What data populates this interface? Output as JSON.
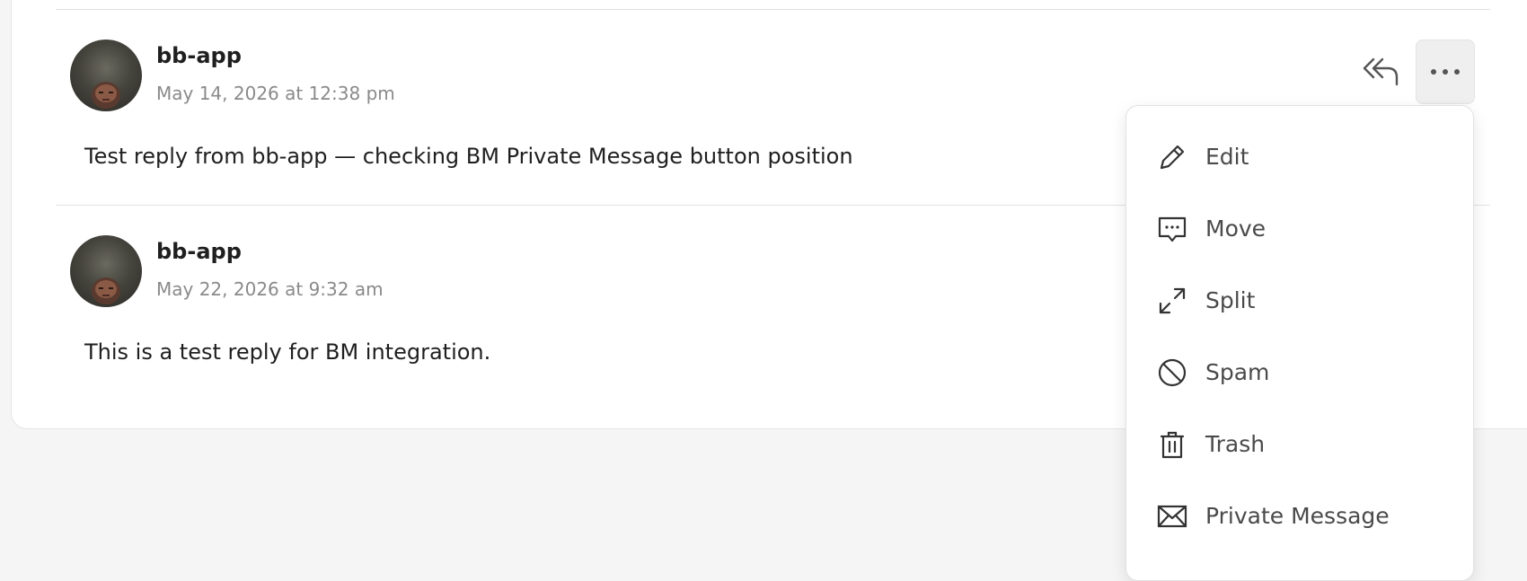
{
  "replies": [
    {
      "author": "bb-app",
      "date": "May 14, 2026 at 12:38 pm",
      "text": "Test reply from bb-app — checking BM Private Message button position"
    },
    {
      "author": "bb-app",
      "date": "May 22, 2026 at 9:32 am",
      "text": "This is a test reply for BM integration."
    }
  ],
  "actions": {
    "reply_icon": "reply-all-icon",
    "more_icon": "ellipsis-icon"
  },
  "menu": {
    "items": [
      {
        "label": "Edit",
        "icon": "pencil-icon"
      },
      {
        "label": "Move",
        "icon": "message-dots-icon"
      },
      {
        "label": "Split",
        "icon": "expand-arrows-icon"
      },
      {
        "label": "Spam",
        "icon": "ban-icon"
      },
      {
        "label": "Trash",
        "icon": "trash-icon"
      },
      {
        "label": "Private Message",
        "icon": "envelope-icon"
      }
    ]
  },
  "colors": {
    "background": "#f5f5f5",
    "card": "#ffffff",
    "text_primary": "#1f1f1f",
    "text_secondary": "#8a8a8a",
    "menu_text": "#4a4a4a"
  }
}
